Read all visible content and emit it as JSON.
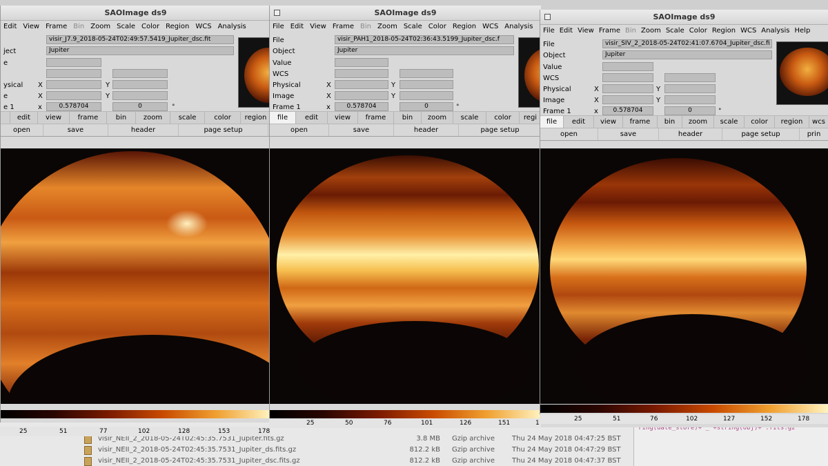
{
  "windows": [
    {
      "title": "SAOImage ds9",
      "menu": [
        {
          "label": "Edit",
          "disabled": false
        },
        {
          "label": "View",
          "disabled": false
        },
        {
          "label": "Frame",
          "disabled": false
        },
        {
          "label": "Bin",
          "disabled": true
        },
        {
          "label": "Zoom",
          "disabled": false
        },
        {
          "label": "Scale",
          "disabled": false
        },
        {
          "label": "Color",
          "disabled": false
        },
        {
          "label": "Region",
          "disabled": false
        },
        {
          "label": "WCS",
          "disabled": false
        },
        {
          "label": "Analysis",
          "disabled": false
        }
      ],
      "info": {
        "file_label": "",
        "file_value": "visir_J7.9_2018-05-24T02:49:57.5419_Jupiter_dsc.fit",
        "object_label": "ject",
        "object_value": "Jupiter",
        "value_label": "e",
        "physical_label": "ysical",
        "image_label": "e",
        "frame_label": "e 1",
        "x_label": "X",
        "y_label": "Y",
        "zoom_label": "x",
        "zoom_value": "0.578704",
        "angle_value": "0",
        "degree": "°"
      },
      "buttons": [
        "",
        "edit",
        "view",
        "frame",
        "bin",
        "zoom",
        "scale",
        "color",
        "region"
      ],
      "buttons2": [
        "open",
        "save",
        "header",
        "page setup"
      ],
      "ticks": [
        "25",
        "51",
        "77",
        "102",
        "128",
        "153",
        "178"
      ]
    },
    {
      "title": "SAOImage ds9",
      "menu": [
        {
          "label": "File",
          "disabled": false
        },
        {
          "label": "Edit",
          "disabled": false
        },
        {
          "label": "View",
          "disabled": false
        },
        {
          "label": "Frame",
          "disabled": false
        },
        {
          "label": "Bin",
          "disabled": true
        },
        {
          "label": "Zoom",
          "disabled": false
        },
        {
          "label": "Scale",
          "disabled": false
        },
        {
          "label": "Color",
          "disabled": false
        },
        {
          "label": "Region",
          "disabled": false
        },
        {
          "label": "WCS",
          "disabled": false
        },
        {
          "label": "Analysis",
          "disabled": false
        }
      ],
      "info": {
        "file_label": "File",
        "file_value": "visir_PAH1_2018-05-24T02:36:43.5199_Jupiter_dsc.f",
        "object_label": "Object",
        "object_value": "Jupiter",
        "value_label": "Value",
        "wcs_label": "WCS",
        "physical_label": "Physical",
        "image_label": "Image",
        "frame_label": "Frame 1",
        "x_label": "X",
        "y_label": "Y",
        "zoom_label": "x",
        "zoom_value": "0.578704",
        "angle_value": "0",
        "degree": "°"
      },
      "buttons": [
        "file",
        "edit",
        "view",
        "frame",
        "bin",
        "zoom",
        "scale",
        "color",
        "regi"
      ],
      "buttons2": [
        "open",
        "save",
        "header",
        "page setup"
      ],
      "ticks": [
        "25",
        "50",
        "76",
        "101",
        "126",
        "151",
        "1"
      ]
    },
    {
      "title": "SAOImage ds9",
      "menu": [
        {
          "label": "File",
          "disabled": false
        },
        {
          "label": "Edit",
          "disabled": false
        },
        {
          "label": "View",
          "disabled": false
        },
        {
          "label": "Frame",
          "disabled": false
        },
        {
          "label": "Bin",
          "disabled": true
        },
        {
          "label": "Zoom",
          "disabled": false
        },
        {
          "label": "Scale",
          "disabled": false
        },
        {
          "label": "Color",
          "disabled": false
        },
        {
          "label": "Region",
          "disabled": false
        },
        {
          "label": "WCS",
          "disabled": false
        },
        {
          "label": "Analysis",
          "disabled": false
        },
        {
          "label": "Help",
          "disabled": false
        }
      ],
      "info": {
        "file_label": "File",
        "file_value": "visir_SIV_2_2018-05-24T02:41:07.6704_Jupiter_dsc.fi",
        "object_label": "Object",
        "object_value": "Jupiter",
        "value_label": "Value",
        "wcs_label": "WCS",
        "physical_label": "Physical",
        "image_label": "Image",
        "frame_label": "Frame 1",
        "x_label": "X",
        "y_label": "Y",
        "zoom_label": "x",
        "zoom_value": "0.578704",
        "angle_value": "0",
        "degree": "°"
      },
      "buttons": [
        "file",
        "edit",
        "view",
        "frame",
        "bin",
        "zoom",
        "scale",
        "color",
        "region",
        "wcs"
      ],
      "buttons2": [
        "open",
        "save",
        "header",
        "page setup",
        "prin"
      ],
      "ticks": [
        "25",
        "51",
        "76",
        "102",
        "127",
        "152",
        "178"
      ]
    }
  ],
  "files": [
    {
      "name": "visir_NEII_2_2018-05-24T02:45:35.7531_Jupiter.fits.gz",
      "size": "3.8 MB",
      "type": "Gzip archive",
      "date": "Thu 24 May 2018 04:47:25 BST"
    },
    {
      "name": "visir_NEII_2_2018-05-24T02:45:35.7531_Jupiter_ds.fits.gz",
      "size": "812.2 kB",
      "type": "Gzip archive",
      "date": "Thu 24 May 2018 04:47:29 BST"
    },
    {
      "name": "visir_NEII_2_2018-05-24T02:45:35.7531_Jupiter_dsc.fits.gz",
      "size": "812.2 kB",
      "type": "Gzip archive",
      "date": "Thu 24 May 2018 04:47:37 BST"
    }
  ],
  "terminal": {
    "line": "ring(date_store)+'_'+string(obj)+'.fits.gz'"
  },
  "colors": {
    "planet_hot": "#fff0b0",
    "planet_mid": "#e07a18",
    "planet_dark": "#5a1405",
    "background": "#0a0606"
  }
}
